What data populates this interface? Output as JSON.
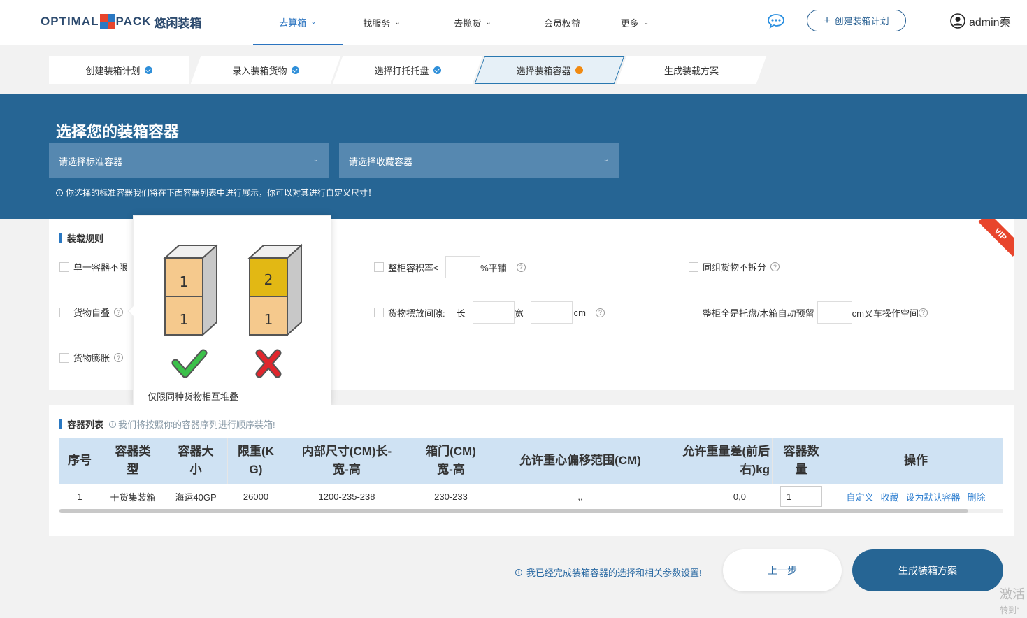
{
  "app": {
    "logo_text_1": "OPTIMAL",
    "logo_text_2": "PACK",
    "logo_cn": "悠闲装箱",
    "brand_color": "#266594"
  },
  "nav": {
    "items": [
      {
        "label": "去算箱",
        "active": true,
        "has_dropdown": true
      },
      {
        "label": "找服务",
        "active": false,
        "has_dropdown": true
      },
      {
        "label": "去揽货",
        "active": false,
        "has_dropdown": true
      },
      {
        "label": "会员权益",
        "active": false,
        "has_dropdown": false
      },
      {
        "label": "更多",
        "active": false,
        "has_dropdown": true
      }
    ],
    "create_plan_label": "创建装箱计划",
    "username": "admin秦"
  },
  "steps": [
    {
      "label": "创建装箱计划",
      "status": "done"
    },
    {
      "label": "录入装箱货物",
      "status": "done"
    },
    {
      "label": "选择打托托盘",
      "status": "done"
    },
    {
      "label": "选择装箱容器",
      "status": "current"
    },
    {
      "label": "生成装载方案",
      "status": "pending"
    }
  ],
  "banner": {
    "title": "选择您的装箱容器",
    "standard_select_placeholder": "请选择标准容器",
    "favorite_select_placeholder": "请选择收藏容器",
    "tip": "你选择的标准容器我们将在下面容器列表中进行展示，你可以对其进行自定义尺寸！"
  },
  "rules": {
    "title": "装载规则",
    "vip_badge": "VIP",
    "single_container": "单一容器不限",
    "self_stack": "货物自叠",
    "expand": "货物膨胀",
    "fill_rate_prefix": "整柜容积率≤",
    "fill_rate_suffix": "%平铺",
    "gap_label": "货物摆放间隙:",
    "gap_length": "长",
    "gap_width": "宽",
    "gap_unit": "cm",
    "group_no_split": "同组货物不拆分",
    "pallet_reserve_prefix": "整柜全是托盘/木箱自动预留",
    "pallet_reserve_suffix": "cm叉车操作空间"
  },
  "popover": {
    "caption": "仅限同种货物相互堆叠",
    "good_stack": [
      "1",
      "1"
    ],
    "bad_stack": [
      "2",
      "1"
    ]
  },
  "container_list": {
    "title": "容器列表",
    "tip": "我们将按照你的容器序列进行顺序装箱!",
    "headers": [
      "序号",
      "容器类\n型",
      "容器大\n小",
      "限重(K\nG)",
      "内部尺寸(CM)长-\n宽-高",
      "箱门(CM)\n宽-高",
      "允许重心偏移范围(CM)",
      "允许重量差(前后\n右)kg",
      "容器数\n量",
      "操作"
    ],
    "rows": [
      {
        "index": "1",
        "type": "干货集装箱",
        "size": "海运40GP",
        "max_weight": "26000",
        "inner_size": "1200-235-238",
        "door": "230-233",
        "cg_offset": ",,",
        "weight_diff": "0,0",
        "quantity": "1",
        "actions": [
          "自定义",
          "收藏",
          "设为默认容器",
          "删除"
        ]
      }
    ]
  },
  "footer": {
    "tip": "我已经完成装箱容器的选择和相关参数设置!",
    "prev_label": "上一步",
    "generate_label": "生成装箱方案"
  },
  "watermark": {
    "line1": "激活",
    "line2": "转到“"
  }
}
